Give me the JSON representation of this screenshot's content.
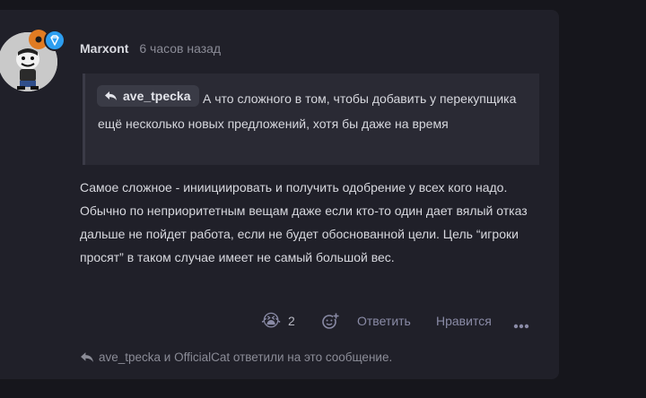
{
  "post": {
    "author": "Marxont",
    "time": "6 часов назад",
    "quote": {
      "author": "ave_tpecka",
      "text": "А что сложного в том, чтобы добавить у перекупщика ещё несколько новых предложений, хотя бы даже на время"
    },
    "body": "Самое сложное - инииции­ровать и получить одобрение у всех кого надо. Обычно по неприоритетным вещам даже если кто-то один дает вялый отказ дальше не пойдет работа, если не будет обоснованной цели. Цель “игроки просят” в таком случае имеет не самый большой вес.",
    "reaction_emoji": "😭",
    "reaction_count": "2",
    "reply_label": "Ответить",
    "like_label": "Нравится",
    "replied_note": "ave_tpecka и OfficialCat ответили на это сообщение."
  },
  "icons": {
    "more": "more-dots-icon",
    "add_reaction": "add-reaction-icon",
    "reply_arrow": "reply-arrow-icon",
    "badge_diamond": "diamond-icon"
  },
  "colors": {
    "page_bg": "#16161c",
    "card_bg": "#202029",
    "quote_bg": "#2a2a34",
    "accent_blue": "#2d9ef0",
    "accent_orange": "#e07b22",
    "muted_text": "#8a8b96"
  }
}
